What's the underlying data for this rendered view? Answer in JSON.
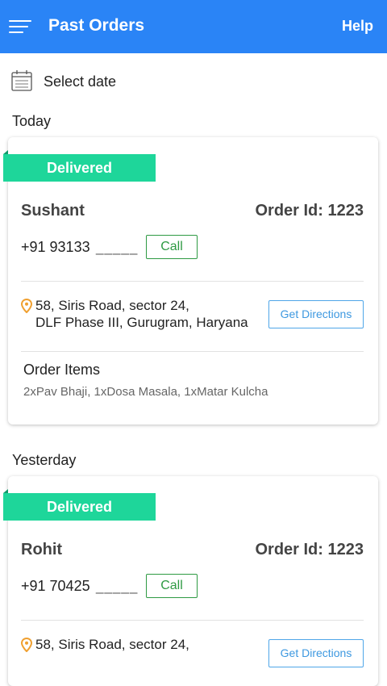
{
  "header": {
    "title": "Past Orders",
    "help_label": "Help"
  },
  "date_filter": {
    "label": "Select date"
  },
  "sections": [
    {
      "label": "Today",
      "order": {
        "status": "Delivered",
        "customer": "Sushant",
        "order_id": "Order Id: 1223",
        "phone": "+91 93133",
        "phone_mask": "_____",
        "call_label": "Call",
        "address_line1": "58, Siris Road, sector 24,",
        "address_line2": "DLF Phase III, Gurugram, Haryana",
        "directions_label": "Get Directions",
        "items_label": "Order Items",
        "items": "2xPav Bhaji, 1xDosa Masala, 1xMatar Kulcha"
      }
    },
    {
      "label": "Yesterday",
      "order": {
        "status": "Delivered",
        "customer": "Rohit",
        "order_id": "Order Id: 1223",
        "phone": "+91 70425",
        "phone_mask": "_____",
        "call_label": "Call",
        "address_line1": "58, Siris Road, sector 24,",
        "directions_label": "Get Directions"
      }
    }
  ],
  "colors": {
    "appbar": "#2a84f6",
    "delivered": "#1ed69a",
    "call": "#2e9a43",
    "directions": "#3d98e0",
    "pin": "#f0a030"
  }
}
